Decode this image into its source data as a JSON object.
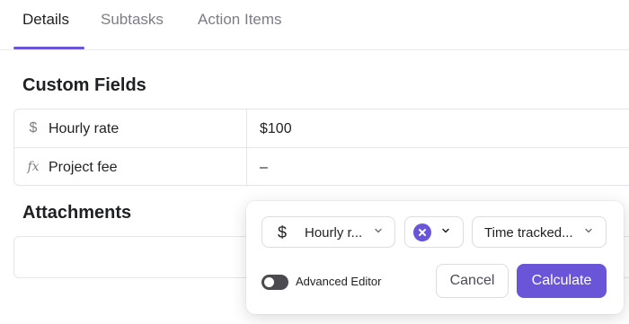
{
  "tabs": [
    {
      "label": "Details"
    },
    {
      "label": "Subtasks"
    },
    {
      "label": "Action Items"
    }
  ],
  "custom_fields": {
    "title": "Custom Fields",
    "rows": [
      {
        "icon": "dollar-icon",
        "name": "Hourly rate",
        "value": "$100"
      },
      {
        "icon": "formula-icon",
        "name": "Project fee",
        "value": "–"
      }
    ]
  },
  "attachments": {
    "title": "Attachments"
  },
  "formula_popover": {
    "field_select": {
      "icon": "dollar-icon",
      "label": "Hourly r..."
    },
    "operator_select": {
      "icon": "multiply-icon"
    },
    "second_field_select": {
      "label": "Time tracked..."
    },
    "advanced_editor": {
      "label": "Advanced Editor",
      "enabled": false
    },
    "cancel_label": "Cancel",
    "calculate_label": "Calculate"
  },
  "colors": {
    "accent": "#6a55d8"
  }
}
